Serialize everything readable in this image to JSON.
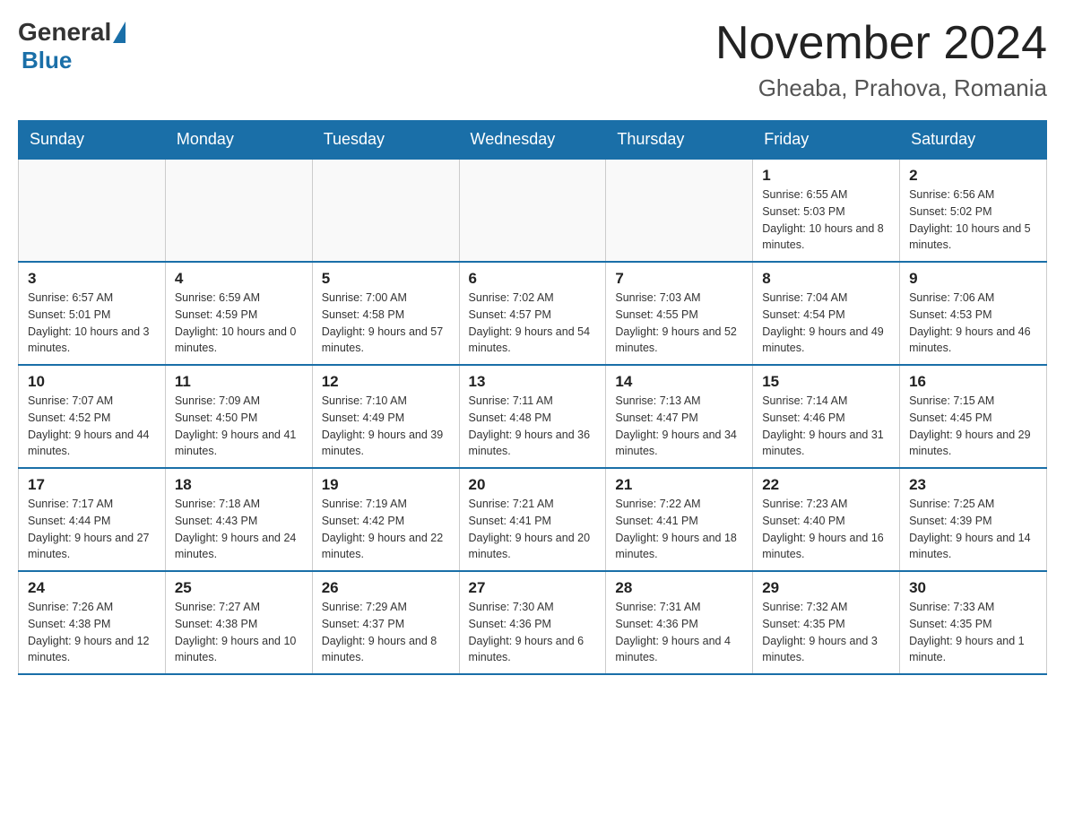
{
  "logo": {
    "general": "General",
    "blue": "Blue"
  },
  "title": {
    "month_year": "November 2024",
    "location": "Gheaba, Prahova, Romania"
  },
  "days_of_week": [
    "Sunday",
    "Monday",
    "Tuesday",
    "Wednesday",
    "Thursday",
    "Friday",
    "Saturday"
  ],
  "weeks": [
    [
      {
        "day": "",
        "info": ""
      },
      {
        "day": "",
        "info": ""
      },
      {
        "day": "",
        "info": ""
      },
      {
        "day": "",
        "info": ""
      },
      {
        "day": "",
        "info": ""
      },
      {
        "day": "1",
        "info": "Sunrise: 6:55 AM\nSunset: 5:03 PM\nDaylight: 10 hours and 8 minutes."
      },
      {
        "day": "2",
        "info": "Sunrise: 6:56 AM\nSunset: 5:02 PM\nDaylight: 10 hours and 5 minutes."
      }
    ],
    [
      {
        "day": "3",
        "info": "Sunrise: 6:57 AM\nSunset: 5:01 PM\nDaylight: 10 hours and 3 minutes."
      },
      {
        "day": "4",
        "info": "Sunrise: 6:59 AM\nSunset: 4:59 PM\nDaylight: 10 hours and 0 minutes."
      },
      {
        "day": "5",
        "info": "Sunrise: 7:00 AM\nSunset: 4:58 PM\nDaylight: 9 hours and 57 minutes."
      },
      {
        "day": "6",
        "info": "Sunrise: 7:02 AM\nSunset: 4:57 PM\nDaylight: 9 hours and 54 minutes."
      },
      {
        "day": "7",
        "info": "Sunrise: 7:03 AM\nSunset: 4:55 PM\nDaylight: 9 hours and 52 minutes."
      },
      {
        "day": "8",
        "info": "Sunrise: 7:04 AM\nSunset: 4:54 PM\nDaylight: 9 hours and 49 minutes."
      },
      {
        "day": "9",
        "info": "Sunrise: 7:06 AM\nSunset: 4:53 PM\nDaylight: 9 hours and 46 minutes."
      }
    ],
    [
      {
        "day": "10",
        "info": "Sunrise: 7:07 AM\nSunset: 4:52 PM\nDaylight: 9 hours and 44 minutes."
      },
      {
        "day": "11",
        "info": "Sunrise: 7:09 AM\nSunset: 4:50 PM\nDaylight: 9 hours and 41 minutes."
      },
      {
        "day": "12",
        "info": "Sunrise: 7:10 AM\nSunset: 4:49 PM\nDaylight: 9 hours and 39 minutes."
      },
      {
        "day": "13",
        "info": "Sunrise: 7:11 AM\nSunset: 4:48 PM\nDaylight: 9 hours and 36 minutes."
      },
      {
        "day": "14",
        "info": "Sunrise: 7:13 AM\nSunset: 4:47 PM\nDaylight: 9 hours and 34 minutes."
      },
      {
        "day": "15",
        "info": "Sunrise: 7:14 AM\nSunset: 4:46 PM\nDaylight: 9 hours and 31 minutes."
      },
      {
        "day": "16",
        "info": "Sunrise: 7:15 AM\nSunset: 4:45 PM\nDaylight: 9 hours and 29 minutes."
      }
    ],
    [
      {
        "day": "17",
        "info": "Sunrise: 7:17 AM\nSunset: 4:44 PM\nDaylight: 9 hours and 27 minutes."
      },
      {
        "day": "18",
        "info": "Sunrise: 7:18 AM\nSunset: 4:43 PM\nDaylight: 9 hours and 24 minutes."
      },
      {
        "day": "19",
        "info": "Sunrise: 7:19 AM\nSunset: 4:42 PM\nDaylight: 9 hours and 22 minutes."
      },
      {
        "day": "20",
        "info": "Sunrise: 7:21 AM\nSunset: 4:41 PM\nDaylight: 9 hours and 20 minutes."
      },
      {
        "day": "21",
        "info": "Sunrise: 7:22 AM\nSunset: 4:41 PM\nDaylight: 9 hours and 18 minutes."
      },
      {
        "day": "22",
        "info": "Sunrise: 7:23 AM\nSunset: 4:40 PM\nDaylight: 9 hours and 16 minutes."
      },
      {
        "day": "23",
        "info": "Sunrise: 7:25 AM\nSunset: 4:39 PM\nDaylight: 9 hours and 14 minutes."
      }
    ],
    [
      {
        "day": "24",
        "info": "Sunrise: 7:26 AM\nSunset: 4:38 PM\nDaylight: 9 hours and 12 minutes."
      },
      {
        "day": "25",
        "info": "Sunrise: 7:27 AM\nSunset: 4:38 PM\nDaylight: 9 hours and 10 minutes."
      },
      {
        "day": "26",
        "info": "Sunrise: 7:29 AM\nSunset: 4:37 PM\nDaylight: 9 hours and 8 minutes."
      },
      {
        "day": "27",
        "info": "Sunrise: 7:30 AM\nSunset: 4:36 PM\nDaylight: 9 hours and 6 minutes."
      },
      {
        "day": "28",
        "info": "Sunrise: 7:31 AM\nSunset: 4:36 PM\nDaylight: 9 hours and 4 minutes."
      },
      {
        "day": "29",
        "info": "Sunrise: 7:32 AM\nSunset: 4:35 PM\nDaylight: 9 hours and 3 minutes."
      },
      {
        "day": "30",
        "info": "Sunrise: 7:33 AM\nSunset: 4:35 PM\nDaylight: 9 hours and 1 minute."
      }
    ]
  ]
}
